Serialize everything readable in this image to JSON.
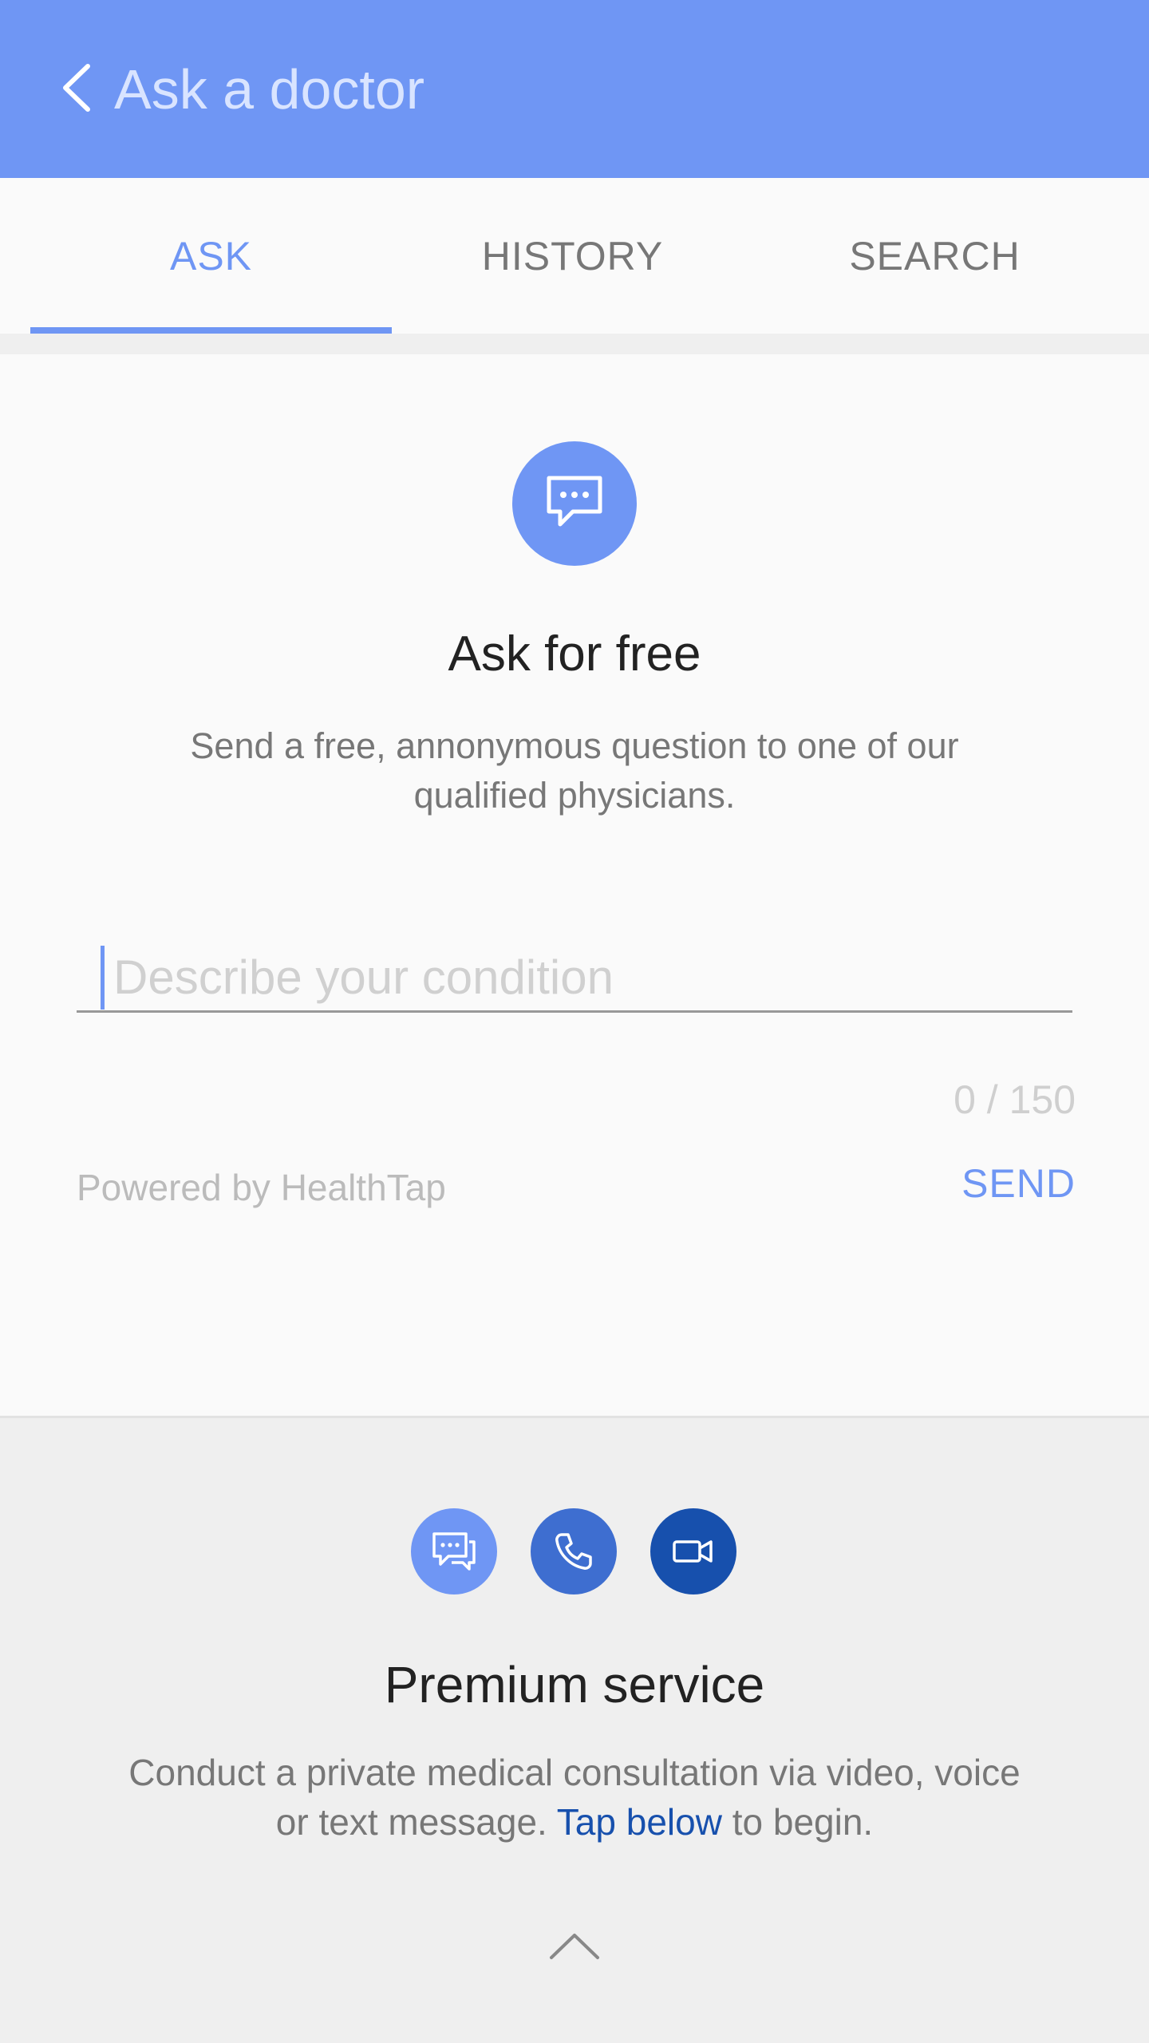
{
  "appbar": {
    "title": "Ask a doctor",
    "back_icon": "chevron-left-icon",
    "color": "#6f96f4"
  },
  "tabs": [
    {
      "label": "ASK",
      "active": true
    },
    {
      "label": "HISTORY",
      "active": false
    },
    {
      "label": "SEARCH",
      "active": false
    }
  ],
  "ask": {
    "icon": "chat-bubble-icon",
    "title": "Ask for free",
    "description": "Send a free, annonymous question to one of our qualified physicians.",
    "input": {
      "value": "",
      "placeholder": "Describe your condition"
    },
    "counter": "0 / 150",
    "powered_by": "Powered by HealthTap",
    "send_label": "SEND"
  },
  "premium": {
    "icons": [
      "text-message-icon",
      "phone-icon",
      "video-camera-icon"
    ],
    "icon_colors": [
      "#6f96f4",
      "#3e6ed0",
      "#1750ad"
    ],
    "title": "Premium service",
    "description_before": "Conduct a private medical consultation via video, voice or text message.",
    "link": "Tap below",
    "description_after": "to begin.",
    "expand_icon": "chevron-up-icon"
  }
}
